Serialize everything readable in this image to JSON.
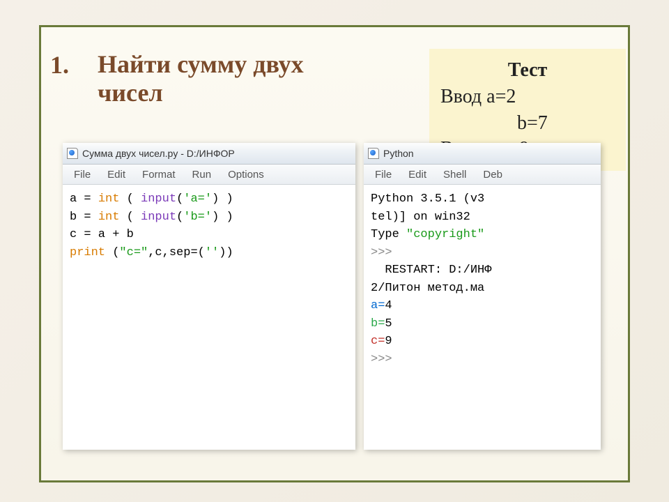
{
  "bullet": "1.",
  "heading_l1": "Найти сумму двух",
  "heading_l2": "чисел",
  "test": {
    "title": "Тест",
    "line1": "Ввод a=2",
    "line2": "b=7",
    "line3": "Вывод c=9"
  },
  "editor": {
    "title": "Сумма двух чисел.py - D:/ИНФОР",
    "menu": [
      "File",
      "Edit",
      "Format",
      "Run",
      "Options"
    ],
    "code": {
      "l1": {
        "a": "a = ",
        "b": "int",
        "c": " ( ",
        "d": "input",
        "e": "(",
        "f": "'a='",
        "g": ") )"
      },
      "l2": {
        "a": "b = ",
        "b": "int",
        "c": " ( ",
        "d": "input",
        "e": "(",
        "f": "'b='",
        "g": ") )"
      },
      "l3": "c = a + b",
      "l4": {
        "a": "print",
        "b": " (",
        "c": "\"c=\"",
        "d": ",c,sep=(",
        "e": "''",
        "f": "))"
      }
    }
  },
  "shell": {
    "title": "Python",
    "menu": [
      "File",
      "Edit",
      "Shell",
      "Deb"
    ],
    "out": {
      "l1": "Python 3.5.1 (v3",
      "l2": "tel)] on win32",
      "l3a": "Type ",
      "l3b": "\"copyright\"",
      "l4": ">>> ",
      "l5": "  RESTART: D:/ИНФ",
      "l6": "2/Питон метод.ма",
      "l7a": "a=",
      "l7b": "4",
      "l8a": "b=",
      "l8b": "5",
      "l9a": "c=",
      "l9b": "9",
      "l10": ">>> "
    }
  }
}
